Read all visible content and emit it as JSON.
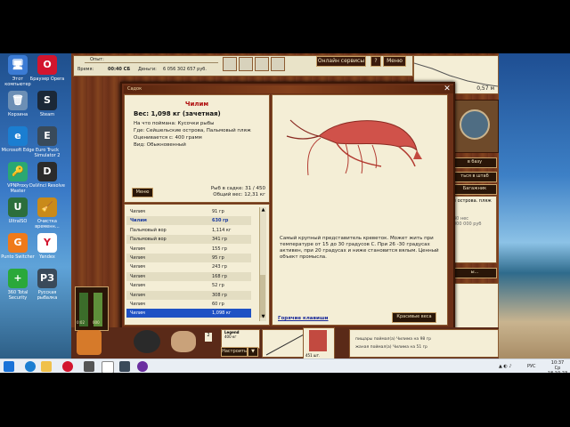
{
  "desktop": {
    "icons": [
      {
        "label": "Этот компьютер",
        "glyph": "🖥",
        "color": "#3b7bd4"
      },
      {
        "label": "Браузер Opera",
        "glyph": "O",
        "color": "#d3152e"
      },
      {
        "label": "Корзина",
        "glyph": "🗑",
        "color": "#6c8fb5"
      },
      {
        "label": "Steam",
        "glyph": "S",
        "color": "#1b2838"
      },
      {
        "label": "Microsoft Edge",
        "glyph": "e",
        "color": "#1b7ed1"
      },
      {
        "label": "Euro Truck Simulator 2",
        "glyph": "E",
        "color": "#394a5a"
      },
      {
        "label": "VPNProxy Master",
        "glyph": "🔑",
        "color": "#2aa873"
      },
      {
        "label": "DaVinci Resolve",
        "glyph": "D",
        "color": "#2b2b2b"
      },
      {
        "label": "UltraISO",
        "glyph": "U",
        "color": "#2c6e3c"
      },
      {
        "label": "Очистка временн…",
        "glyph": "🧹",
        "color": "#c98a1a"
      },
      {
        "label": "Punto Switcher",
        "glyph": "G",
        "color": "#ef7a1a"
      },
      {
        "label": "Yandex",
        "glyph": "Y",
        "color": "#ffffff"
      },
      {
        "label": "360 Total Security",
        "glyph": "+",
        "color": "#2aa83a"
      },
      {
        "label": "Русская рыбалка",
        "glyph": "РЗ",
        "color": "#3a4a5a"
      }
    ]
  },
  "game": {
    "topbar": {
      "label_exp": "Опыт:",
      "label_time": "Время:",
      "time": "00:40 СБ",
      "label_money": "Деньги:",
      "money": "6 056 302 657 руб.",
      "online_btn": "Онлайн сервисы",
      "help_btn": "?",
      "menu_btn": "Меню"
    },
    "right_panel": {
      "depth": "0,57 м",
      "base_btn": "в базу",
      "hq_btn": "ться в штаб",
      "trunk_btn": "Багажник",
      "location_text": "е острова. пляж",
      "small_text_1": "40 нес",
      "small_text_2": "000 000 руб",
      "menu_dots": "ы..."
    },
    "dialog": {
      "title": "Садок",
      "close": "✕",
      "fish_name": "Чилим",
      "weight": "Вес: 1,098 кг (зачетная)",
      "caught_on": "На что поймана: Кусочки рыбы",
      "where": "Где: Сейшельские острова, Пальмовый пляж",
      "valued": "Оценивается с: 400 грамм",
      "kind": "Вид: Обыкновенный",
      "menu_btn": "Меню",
      "fish_count": "Рыб в садке: 31 / 450",
      "total_weight": "Общий вес: 12,31 кг",
      "description": "Самый крупный представитель креветок. Может жить при температуре от 15 до 30 градусов С. При 26 -30 градусах активен, при 20 градусах и ниже становится вялым. Ценный объект промысла.",
      "hotkeys_link": "Горячие клавиши",
      "red_weights_btn": "Красивые веса",
      "list": [
        {
          "name": "Чилим",
          "weight": "91 гр"
        },
        {
          "name": "Чилим",
          "weight": "630 гр"
        },
        {
          "name": "Пальмовый вор",
          "weight": "1,114 кг"
        },
        {
          "name": "Пальмовый вор",
          "weight": "341 гр"
        },
        {
          "name": "Чилим",
          "weight": "155 гр"
        },
        {
          "name": "Чилим",
          "weight": "95 гр"
        },
        {
          "name": "Чилим",
          "weight": "243 гр"
        },
        {
          "name": "Чилим",
          "weight": "168 гр"
        },
        {
          "name": "Чилим",
          "weight": "52 гр"
        },
        {
          "name": "Чилим",
          "weight": "308 гр"
        },
        {
          "name": "Чилим",
          "weight": "60 гр"
        },
        {
          "name": "Чилим",
          "weight": "1,098 кг"
        }
      ],
      "bold_index": 1,
      "selected_index": 11
    },
    "bottom": {
      "gauge1": "0:02",
      "gauge2": "000",
      "count": "2",
      "legend_title": "Legend",
      "legend_weight": "400 кг",
      "setup_btn": "Настроить",
      "log1": "пищары поймал(а) Чилима на 98 гр",
      "log2": "жаная поймал(а) Чилима на 51 гр",
      "bag_label": "451 шт."
    }
  },
  "taskbar": {
    "lang": "РУС",
    "time": "10:37",
    "date": "Ср 18.10.23"
  },
  "colors": {
    "accent_red": "#b01010",
    "selection_blue": "#1f52c4",
    "wood": "#6b3018"
  }
}
